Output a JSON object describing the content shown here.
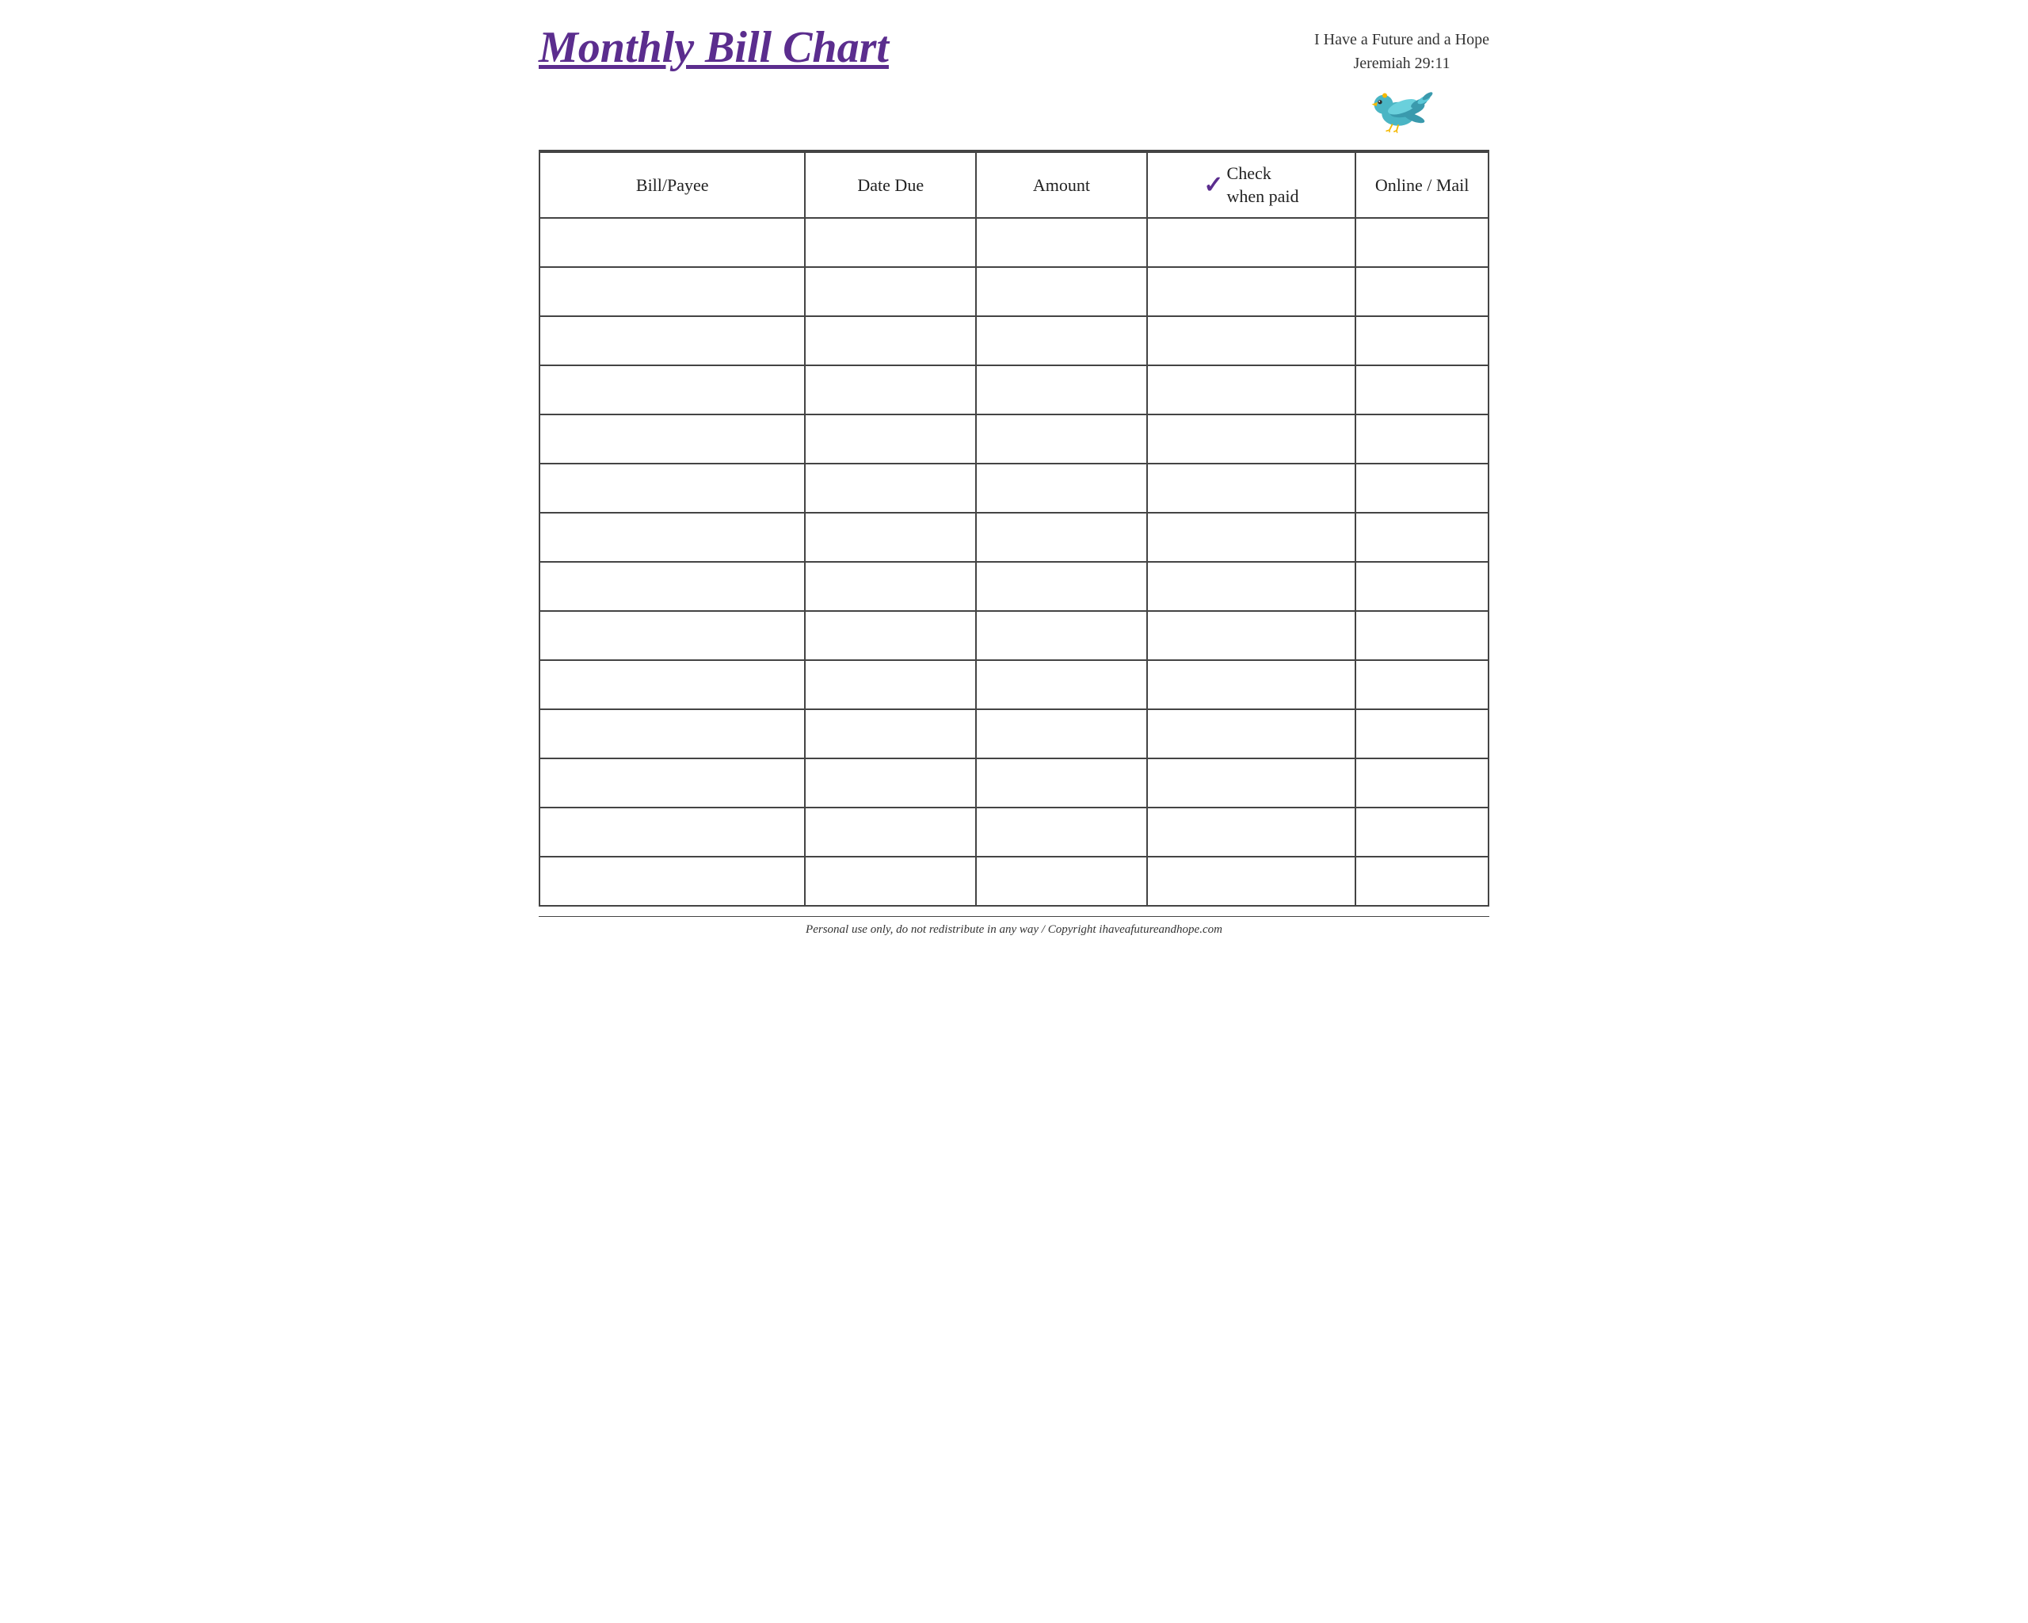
{
  "header": {
    "title": "Monthly Bill Chart",
    "tagline_line1": "I Have a Future and a Hope",
    "tagline_line2": "Jeremiah 29:11"
  },
  "table": {
    "columns": [
      {
        "id": "bill-payee",
        "label": "Bill/Payee"
      },
      {
        "id": "date-due",
        "label": "Date Due"
      },
      {
        "id": "amount",
        "label": "Amount"
      },
      {
        "id": "check-when-paid",
        "label_check": "✓",
        "label_text_line1": "Check",
        "label_text_line2": "when paid"
      },
      {
        "id": "online-mail",
        "label": "Online / Mail"
      }
    ],
    "row_count": 14
  },
  "footer": {
    "text": "Personal use only, do not redistribute in any way / Copyright ihaveafutureandhope.com"
  },
  "colors": {
    "purple": "#5b2d8e",
    "border": "#444444",
    "text": "#222222"
  }
}
